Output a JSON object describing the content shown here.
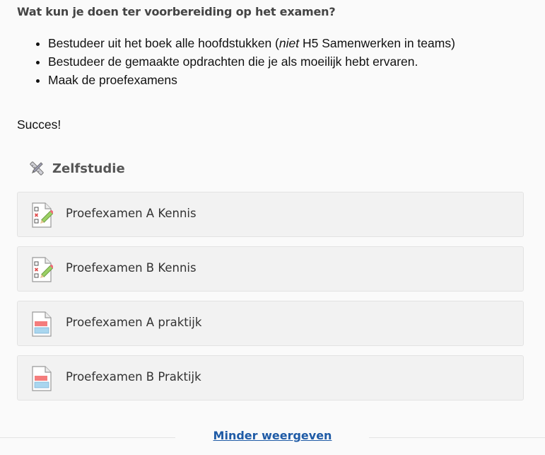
{
  "page": {
    "heading": "Wat kun je doen ter voorbereiding op het examen?",
    "bullets": [
      {
        "before": "Bestudeer uit het boek alle hoofdstukken (",
        "emphasis": "niet",
        "after": " H5 Samenwerken in teams)"
      },
      {
        "before": "Bestudeer de gemaakte opdrachten die je als moeilijk hebt ervaren.",
        "emphasis": "",
        "after": ""
      },
      {
        "before": "Maak de proefexamens",
        "emphasis": "",
        "after": ""
      }
    ],
    "closing": "Succes!"
  },
  "section": {
    "icon": "tools-icon",
    "title": "Zelfstudie",
    "items": [
      {
        "label": "Proefexamen A Kennis",
        "icon": "quiz-icon"
      },
      {
        "label": "Proefexamen B Kennis",
        "icon": "quiz-icon"
      },
      {
        "label": "Proefexamen A praktijk",
        "icon": "assignment-icon"
      },
      {
        "label": "Proefexamen B Praktijk",
        "icon": "assignment-icon"
      }
    ]
  },
  "footer": {
    "toggle_label": "Minder weergeven"
  },
  "colors": {
    "link": "#1f5ba6",
    "card_bg": "#f2f2f2",
    "heading": "#444444"
  }
}
